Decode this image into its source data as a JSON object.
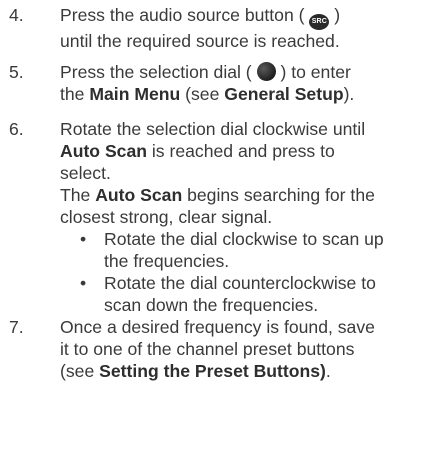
{
  "steps": [
    {
      "number": "4.",
      "line1a": "Press the audio source button (",
      "icon_label": "SRC",
      "line1b": ")",
      "line2": "until the required source is reached."
    },
    {
      "number": "5.",
      "line1a": "Press the selection dial (",
      "line1b": ") to enter",
      "line2a": "the ",
      "main_menu": "Main Menu",
      "line2b": " (see ",
      "general_setup": "General Setup",
      "line2c": ")."
    },
    {
      "number": "6.",
      "line1": "Rotate the selection dial clockwise until",
      "auto_scan": "Auto Scan",
      "line2b": " is reached and press to",
      "line3": "select.",
      "line4a": "The ",
      "line4_bold": "Auto Scan",
      "line4b": " begins searching for the",
      "line5": "closest strong, clear signal.",
      "bullets": [
        {
          "dot": "•",
          "line1": "Rotate the dial clockwise to scan up",
          "line2": "the frequencies."
        },
        {
          "dot": "•",
          "line1": "Rotate the dial counterclockwise to",
          "line2": "scan down the frequencies."
        }
      ]
    },
    {
      "number": "7.",
      "line1": "Once a desired frequency is found, save",
      "line2": "it to one of the channel preset buttons",
      "line3a": "(see ",
      "line3_bold": "Setting the Preset Buttons)",
      "line3b": "."
    }
  ]
}
